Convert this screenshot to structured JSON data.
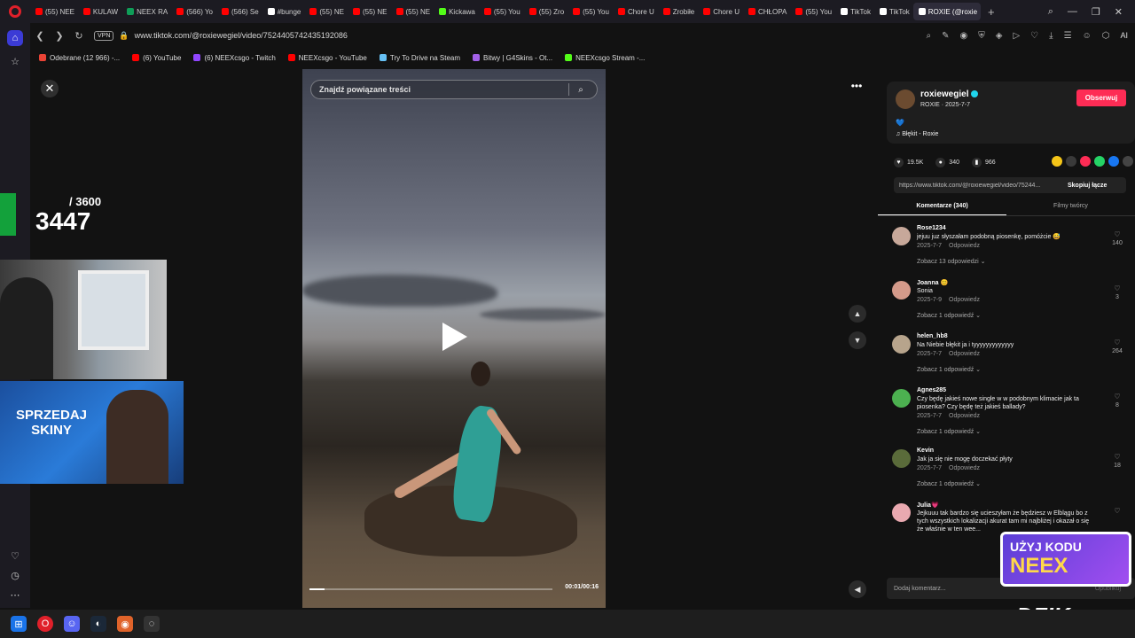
{
  "browser": {
    "tabs": [
      {
        "label": "(55) NEE",
        "color": "#ff0000"
      },
      {
        "label": "KULAW",
        "color": "#ff0000"
      },
      {
        "label": "NEEX RA",
        "color": "#0f9d58"
      },
      {
        "label": "(566) Yo",
        "color": "#ff0000"
      },
      {
        "label": "(566) Se",
        "color": "#ff0000"
      },
      {
        "label": "#bunge",
        "color": "#ffffff"
      },
      {
        "label": "(55) NE",
        "color": "#ff0000"
      },
      {
        "label": "(55) NE",
        "color": "#ff0000"
      },
      {
        "label": "(55) NE",
        "color": "#ff0000"
      },
      {
        "label": "Kickawa",
        "color": "#53fc18"
      },
      {
        "label": "(55) You",
        "color": "#ff0000"
      },
      {
        "label": "(55) Zro",
        "color": "#ff0000"
      },
      {
        "label": "(55) You",
        "color": "#ff0000"
      },
      {
        "label": "Chore U",
        "color": "#ff0000"
      },
      {
        "label": "Zrobiłe",
        "color": "#ff0000"
      },
      {
        "label": "Chore U",
        "color": "#ff0000"
      },
      {
        "label": "CHŁOPA",
        "color": "#ff0000"
      },
      {
        "label": "(55) You",
        "color": "#ff0000"
      },
      {
        "label": "TikTok",
        "color": "#ffffff"
      },
      {
        "label": "TikTok",
        "color": "#ffffff"
      },
      {
        "label": "ROXIE (@roxie",
        "color": "#ffffff",
        "active": true
      }
    ],
    "add_tab": "+",
    "vpn": "VPN",
    "url": "www.tiktok.com/@roxiewegiel/video/7524405742435192086",
    "ai_label": "AI",
    "bookmarks": [
      {
        "label": "Odebrane (12 966) -...",
        "color": "#ea4335"
      },
      {
        "label": "(6) YouTube",
        "color": "#ff0000"
      },
      {
        "label": "(6) NEEXcsgo - Twitch",
        "color": "#9146ff"
      },
      {
        "label": "NEEXcsgo - YouTube",
        "color": "#ff0000"
      },
      {
        "label": "Try To Drive na Steam",
        "color": "#66c0f4"
      },
      {
        "label": "Bitwy | G4Skins - Ot...",
        "color": "#a260e8"
      },
      {
        "label": "NEEXcsgo Stream -...",
        "color": "#53fc18"
      }
    ]
  },
  "video": {
    "search_placeholder": "Znajdź powiązane treści",
    "time": "00:01/00:16",
    "progress": 0.0625
  },
  "panel": {
    "author": "roxiewegiel",
    "author_sub": "ROXIE · 2025-7-7",
    "follow_label": "Obserwuj",
    "heart": "💙",
    "music": "♫  Błękit - Roxie",
    "likes": "19.5K",
    "comments": "340",
    "saves": "966",
    "link": "https://www.tiktok.com/@roxiewegiel/video/75244...",
    "copy_label": "Skopiuj łącze",
    "tab_comments": "Komentarze (340)",
    "tab_creator": "Filmy twórcy",
    "add_comment": "Dodaj komentarz...",
    "post_label": "Opublikuj",
    "reply_label": "Odpowiedz"
  },
  "comments": [
    {
      "user": "Rose1234",
      "text": "jejuu juz słyszałam podobną piosenkę, pomóżcie 😅",
      "date": "2025-7-7",
      "replies": "Zobacz 13 odpowiedzi ⌄",
      "likes": "140",
      "avatar_color": "#c7a89a"
    },
    {
      "user": "Joanna 😊",
      "text": "Sonia",
      "date": "2025-7-9",
      "replies": "Zobacz 1 odpowiedź ⌄",
      "likes": "3",
      "avatar_color": "#d49a8a"
    },
    {
      "user": "helen_hb8",
      "text": "Na Niebie błękit ja i tyyyyyyyyyyyyy",
      "date": "2025-7-7",
      "replies": "Zobacz 1 odpowiedź ⌄",
      "likes": "264",
      "avatar_color": "#b7a48c"
    },
    {
      "user": "Agnes285",
      "text": "Czy będę jakieś nowe single w w podobnym klimacie jak ta piosenka? Czy będę też jakieś ballady?",
      "date": "2025-7-7",
      "replies": "Zobacz 1 odpowiedź ⌄",
      "likes": "8",
      "avatar_color": "#4cb050"
    },
    {
      "user": "Kevin",
      "text": "Jak ja się nie mogę doczekać płyty",
      "date": "2025-7-7",
      "replies": "Zobacz 1 odpowiedź ⌄",
      "likes": "18",
      "avatar_color": "#5a6b3a"
    },
    {
      "user": "Julia💗",
      "text": "Jejkuuu tak bardzo się ucieszyłam że będziesz w Elblągu bo z tych wszystkich lokalizacji akurat tam mi najbliżej i okazał o się że właśnie w ten wee...",
      "date": "",
      "replies": "",
      "likes": "",
      "avatar_color": "#e9a9b0"
    }
  ],
  "overlay": {
    "counter_max": "/ 3600",
    "counter_value": "3447",
    "ad_text": "SPRZEDAJ SKINY",
    "promo_line1": "UŻYJ KODU",
    "promo_line2": "NEEX",
    "brand": "DZIK"
  }
}
